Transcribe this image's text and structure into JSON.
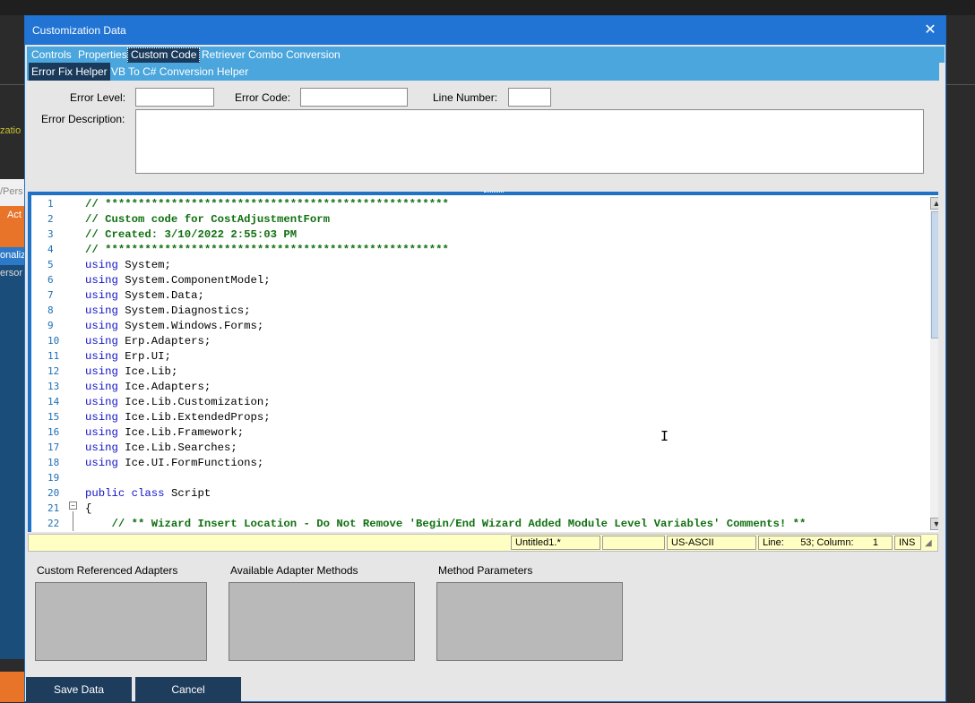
{
  "window": {
    "title": "Customization Data",
    "close_icon": "✕"
  },
  "tabs_row1": [
    "Controls",
    "Properties",
    "Custom Code",
    "Retriever Combo Conversion"
  ],
  "tabs_row2": [
    "Error Fix Helper",
    "VB To C# Conversion Helper"
  ],
  "error_panel": {
    "error_level_label": "Error Level:",
    "error_code_label": "Error Code:",
    "line_number_label": "Line Number:",
    "error_description_label": "Error Description:",
    "error_level_value": "",
    "error_code_value": "",
    "line_number_value": "",
    "error_description_value": ""
  },
  "code_lines": [
    {
      "n": "1",
      "text": "// ****************************************************"
    },
    {
      "n": "2",
      "text": "// Custom code for CostAdjustmentForm"
    },
    {
      "n": "3",
      "text": "// Created: 3/10/2022 2:55:03 PM"
    },
    {
      "n": "4",
      "text": "// ****************************************************"
    },
    {
      "n": "5",
      "kw": "using",
      "text": " System;"
    },
    {
      "n": "6",
      "kw": "using",
      "text": " System.ComponentModel;"
    },
    {
      "n": "7",
      "kw": "using",
      "text": " System.Data;"
    },
    {
      "n": "8",
      "kw": "using",
      "text": " System.Diagnostics;"
    },
    {
      "n": "9",
      "kw": "using",
      "text": " System.Windows.Forms;"
    },
    {
      "n": "10",
      "kw": "using",
      "text": " Erp.Adapters;"
    },
    {
      "n": "11",
      "kw": "using",
      "text": " Erp.UI;"
    },
    {
      "n": "12",
      "kw": "using",
      "text": " Ice.Lib;"
    },
    {
      "n": "13",
      "kw": "using",
      "text": " Ice.Adapters;"
    },
    {
      "n": "14",
      "kw": "using",
      "text": " Ice.Lib.Customization;"
    },
    {
      "n": "15",
      "kw": "using",
      "text": " Ice.Lib.ExtendedProps;"
    },
    {
      "n": "16",
      "kw": "using",
      "text": " Ice.Lib.Framework;"
    },
    {
      "n": "17",
      "kw": "using",
      "text": " Ice.Lib.Searches;"
    },
    {
      "n": "18",
      "kw": "using",
      "text": " Ice.UI.FormFunctions;"
    },
    {
      "n": "19",
      "text": ""
    },
    {
      "n": "20",
      "kw": "public class",
      "text": " Script"
    },
    {
      "n": "21",
      "text": "{"
    },
    {
      "n": "22",
      "text": "    // ** Wizard Insert Location - Do Not Remove 'Begin/End Wizard Added Module Level Variables' Comments! **"
    }
  ],
  "statusbar": {
    "file": "Untitled1.*",
    "empty": "",
    "encoding": "US-ASCII",
    "position": "Line:      53; Column:       1",
    "mode": "INS"
  },
  "adapters": {
    "custom_referenced_label": "Custom Referenced Adapters",
    "available_methods_label": "Available Adapter Methods",
    "method_parameters_label": "Method Parameters"
  },
  "buttons": {
    "save": "Save Data",
    "cancel": "Cancel"
  },
  "background": {
    "tab_fragment": "/Pers",
    "text1": "zatio",
    "text2": "onaliz",
    "text3": "ersor",
    "text4": "Act"
  }
}
